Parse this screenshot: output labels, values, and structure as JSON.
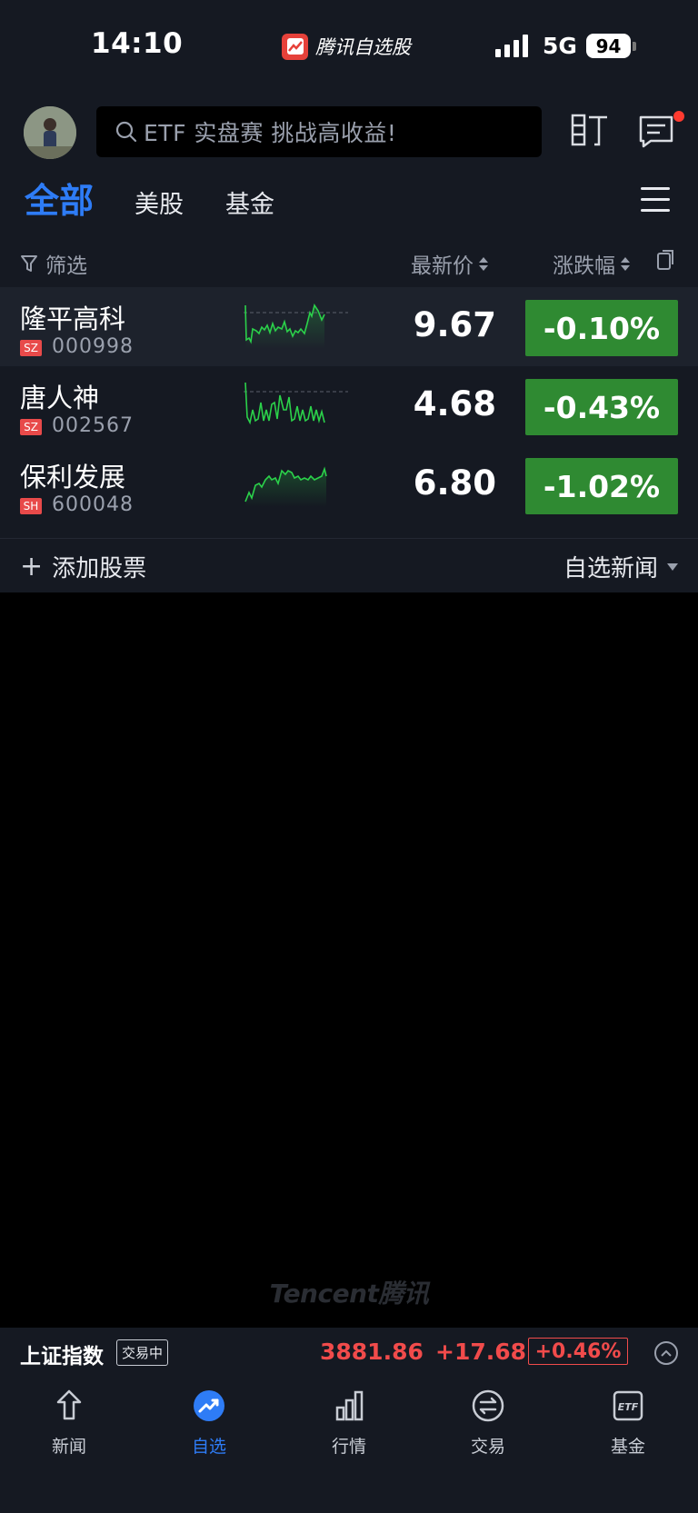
{
  "status_bar": {
    "time": "14:10",
    "app_name": "腾讯自选股",
    "network": "5G",
    "battery": "94"
  },
  "header": {
    "search_placeholder": "ETF 实盘赛 挑战高收益!",
    "ding_icon": "ding-icon",
    "message_icon": "message-icon"
  },
  "tabs": [
    {
      "label": "全部",
      "active": true
    },
    {
      "label": "美股",
      "active": false
    },
    {
      "label": "基金",
      "active": false
    }
  ],
  "columns": {
    "filter": "筛选",
    "price": "最新价",
    "change": "涨跌幅"
  },
  "stocks": [
    {
      "name": "隆平高科",
      "market": "SZ",
      "code": "000998",
      "price": "9.67",
      "change": "-0.10%"
    },
    {
      "name": "唐人神",
      "market": "SZ",
      "code": "002567",
      "price": "4.68",
      "change": "-0.43%"
    },
    {
      "name": "保利发展",
      "market": "SH",
      "code": "600048",
      "price": "6.80",
      "change": "-1.02%"
    }
  ],
  "actions": {
    "add_stock": "添加股票",
    "watch_news": "自选新闻"
  },
  "watermark": "Tencent腾讯",
  "index_bar": {
    "name": "上证指数",
    "status": "交易中",
    "value": "3881.86",
    "change": "+17.68",
    "percent": "+0.46%"
  },
  "nav": [
    {
      "label": "新闻",
      "icon": "news-icon",
      "active": false
    },
    {
      "label": "自选",
      "icon": "watchlist-icon",
      "active": true
    },
    {
      "label": "行情",
      "icon": "market-icon",
      "active": false
    },
    {
      "label": "交易",
      "icon": "trade-icon",
      "active": false
    },
    {
      "label": "基金",
      "icon": "fund-icon",
      "active": false
    }
  ],
  "colors": {
    "accent": "#2e7cf6",
    "down_green": "#2f8a32",
    "up_red": "#f14b4b",
    "background": "#151922"
  }
}
